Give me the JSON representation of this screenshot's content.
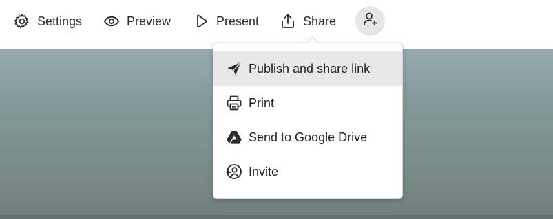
{
  "toolbar": {
    "settings_label": "Settings",
    "preview_label": "Preview",
    "present_label": "Present",
    "share_label": "Share"
  },
  "share_menu": {
    "items": [
      {
        "label": "Publish and share link",
        "icon": "send-icon",
        "highlighted": true
      },
      {
        "label": "Print",
        "icon": "printer-icon",
        "highlighted": false
      },
      {
        "label": "Send to Google Drive",
        "icon": "google-drive-icon",
        "highlighted": false
      },
      {
        "label": "Invite",
        "icon": "invite-user-icon",
        "highlighted": false
      }
    ]
  },
  "colors": {
    "menu_highlight": "#e8e8e8",
    "toolbar_bg": "#ffffff",
    "avatar_button_bg": "#e6e6e6",
    "canvas_top": "#97aaae",
    "canvas_bottom": "#6f7f7c"
  }
}
